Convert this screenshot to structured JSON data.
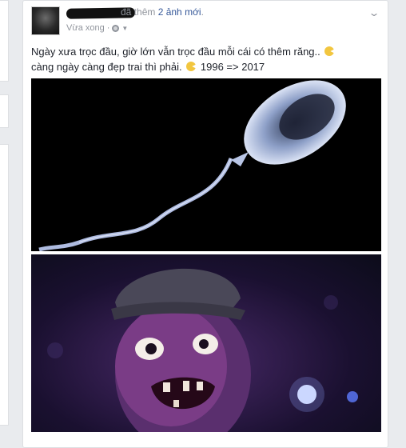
{
  "post": {
    "action_prefix": "đã thêm",
    "action_link": "2 ảnh mới",
    "action_suffix": ".",
    "timestamp": "Vừa xong",
    "separator": "·",
    "privacy_icon": "globe-icon",
    "text_line1": "Ngày xưa trọc đầu, giờ lớn vẫn trọc đầu mỗi cái có thêm răng..",
    "text_line2": "càng ngày càng đẹp trai thì phải.",
    "text_years": "1996 => 2017",
    "emoji_icon": "pacman-emoticon-icon",
    "photos": [
      {
        "subject": "sperm-cell-image"
      },
      {
        "subject": "grinning-man-image"
      }
    ]
  },
  "colors": {
    "link": "#365899",
    "meta": "#90949c",
    "text": "#1d2129",
    "page_bg": "#e9ebee",
    "emoji": "#f2c63f"
  }
}
